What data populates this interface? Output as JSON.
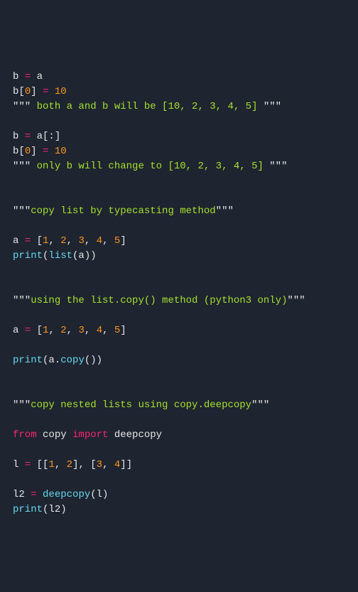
{
  "code": {
    "lines": [
      {
        "segments": [
          {
            "text": "b ",
            "cls": "tk-var"
          },
          {
            "text": "= ",
            "cls": "tk-op"
          },
          {
            "text": "a",
            "cls": "tk-var"
          }
        ]
      },
      {
        "segments": [
          {
            "text": "b",
            "cls": "tk-var"
          },
          {
            "text": "[",
            "cls": "tk-punc"
          },
          {
            "text": "0",
            "cls": "tk-num"
          },
          {
            "text": "] ",
            "cls": "tk-punc"
          },
          {
            "text": "= ",
            "cls": "tk-op"
          },
          {
            "text": "10",
            "cls": "tk-num"
          }
        ]
      },
      {
        "segments": [
          {
            "text": "\"\"\"",
            "cls": "tk-strq"
          },
          {
            "text": " both a and b will be [10, 2, 3, 4, 5] ",
            "cls": "tk-str"
          },
          {
            "text": "\"\"\"",
            "cls": "tk-strq"
          }
        ]
      },
      {
        "segments": []
      },
      {
        "segments": [
          {
            "text": "b ",
            "cls": "tk-var"
          },
          {
            "text": "= ",
            "cls": "tk-op"
          },
          {
            "text": "a",
            "cls": "tk-var"
          },
          {
            "text": "[:]",
            "cls": "tk-punc"
          }
        ]
      },
      {
        "segments": [
          {
            "text": "b",
            "cls": "tk-var"
          },
          {
            "text": "[",
            "cls": "tk-punc"
          },
          {
            "text": "0",
            "cls": "tk-num"
          },
          {
            "text": "] ",
            "cls": "tk-punc"
          },
          {
            "text": "= ",
            "cls": "tk-op"
          },
          {
            "text": "10",
            "cls": "tk-num"
          }
        ]
      },
      {
        "segments": [
          {
            "text": "\"\"\"",
            "cls": "tk-strq"
          },
          {
            "text": " only b will change to [10, 2, 3, 4, 5] ",
            "cls": "tk-str"
          },
          {
            "text": "\"\"\"",
            "cls": "tk-strq"
          }
        ]
      },
      {
        "segments": []
      },
      {
        "segments": []
      },
      {
        "segments": [
          {
            "text": "\"\"\"",
            "cls": "tk-strq"
          },
          {
            "text": "copy list by typecasting method",
            "cls": "tk-str"
          },
          {
            "text": "\"\"\"",
            "cls": "tk-strq"
          }
        ]
      },
      {
        "segments": []
      },
      {
        "segments": [
          {
            "text": "a ",
            "cls": "tk-var"
          },
          {
            "text": "= ",
            "cls": "tk-op"
          },
          {
            "text": "[",
            "cls": "tk-punc"
          },
          {
            "text": "1",
            "cls": "tk-num"
          },
          {
            "text": ", ",
            "cls": "tk-punc"
          },
          {
            "text": "2",
            "cls": "tk-num"
          },
          {
            "text": ", ",
            "cls": "tk-punc"
          },
          {
            "text": "3",
            "cls": "tk-num"
          },
          {
            "text": ", ",
            "cls": "tk-punc"
          },
          {
            "text": "4",
            "cls": "tk-num"
          },
          {
            "text": ", ",
            "cls": "tk-punc"
          },
          {
            "text": "5",
            "cls": "tk-num"
          },
          {
            "text": "]",
            "cls": "tk-punc"
          }
        ]
      },
      {
        "segments": [
          {
            "text": "print",
            "cls": "tk-func"
          },
          {
            "text": "(",
            "cls": "tk-punc"
          },
          {
            "text": "list",
            "cls": "tk-func"
          },
          {
            "text": "(a))",
            "cls": "tk-punc"
          }
        ]
      },
      {
        "segments": []
      },
      {
        "segments": []
      },
      {
        "segments": [
          {
            "text": "\"\"\"",
            "cls": "tk-strq"
          },
          {
            "text": "using the list.copy() method (python3 only)",
            "cls": "tk-str"
          },
          {
            "text": "\"\"\"",
            "cls": "tk-strq"
          }
        ]
      },
      {
        "segments": []
      },
      {
        "segments": [
          {
            "text": "a ",
            "cls": "tk-var"
          },
          {
            "text": "= ",
            "cls": "tk-op"
          },
          {
            "text": "[",
            "cls": "tk-punc"
          },
          {
            "text": "1",
            "cls": "tk-num"
          },
          {
            "text": ", ",
            "cls": "tk-punc"
          },
          {
            "text": "2",
            "cls": "tk-num"
          },
          {
            "text": ", ",
            "cls": "tk-punc"
          },
          {
            "text": "3",
            "cls": "tk-num"
          },
          {
            "text": ", ",
            "cls": "tk-punc"
          },
          {
            "text": "4",
            "cls": "tk-num"
          },
          {
            "text": ", ",
            "cls": "tk-punc"
          },
          {
            "text": "5",
            "cls": "tk-num"
          },
          {
            "text": "]",
            "cls": "tk-punc"
          }
        ]
      },
      {
        "segments": []
      },
      {
        "segments": [
          {
            "text": "print",
            "cls": "tk-func"
          },
          {
            "text": "(a.",
            "cls": "tk-punc"
          },
          {
            "text": "copy",
            "cls": "tk-func"
          },
          {
            "text": "())",
            "cls": "tk-punc"
          }
        ]
      },
      {
        "segments": []
      },
      {
        "segments": []
      },
      {
        "segments": [
          {
            "text": "\"\"\"",
            "cls": "tk-strq"
          },
          {
            "text": "copy nested lists using copy.deepcopy",
            "cls": "tk-str"
          },
          {
            "text": "\"\"\"",
            "cls": "tk-strq"
          }
        ]
      },
      {
        "segments": []
      },
      {
        "segments": [
          {
            "text": "from ",
            "cls": "tk-kw"
          },
          {
            "text": "copy ",
            "cls": "tk-var"
          },
          {
            "text": "import ",
            "cls": "tk-kw"
          },
          {
            "text": "deepcopy",
            "cls": "tk-var"
          }
        ]
      },
      {
        "segments": []
      },
      {
        "segments": [
          {
            "text": "l ",
            "cls": "tk-var"
          },
          {
            "text": "= ",
            "cls": "tk-op"
          },
          {
            "text": "[[",
            "cls": "tk-punc"
          },
          {
            "text": "1",
            "cls": "tk-num"
          },
          {
            "text": ", ",
            "cls": "tk-punc"
          },
          {
            "text": "2",
            "cls": "tk-num"
          },
          {
            "text": "], [",
            "cls": "tk-punc"
          },
          {
            "text": "3",
            "cls": "tk-num"
          },
          {
            "text": ", ",
            "cls": "tk-punc"
          },
          {
            "text": "4",
            "cls": "tk-num"
          },
          {
            "text": "]]",
            "cls": "tk-punc"
          }
        ]
      },
      {
        "segments": []
      },
      {
        "segments": [
          {
            "text": "l2 ",
            "cls": "tk-var"
          },
          {
            "text": "= ",
            "cls": "tk-op"
          },
          {
            "text": "deepcopy",
            "cls": "tk-func"
          },
          {
            "text": "(l)",
            "cls": "tk-punc"
          }
        ]
      },
      {
        "segments": [
          {
            "text": "print",
            "cls": "tk-func"
          },
          {
            "text": "(l2)",
            "cls": "tk-punc"
          }
        ]
      }
    ]
  }
}
